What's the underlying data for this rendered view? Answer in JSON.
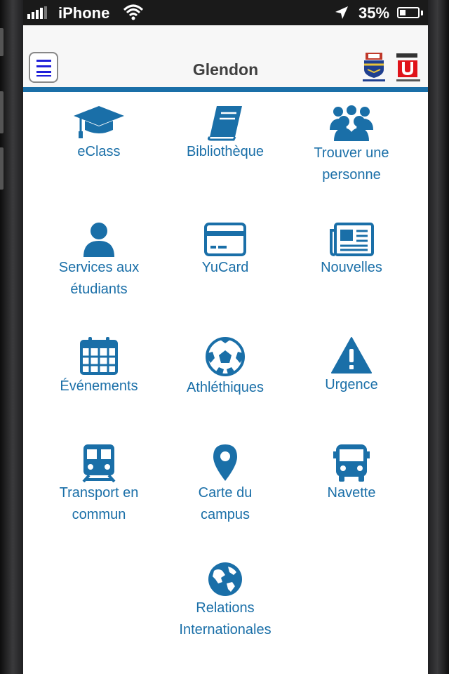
{
  "status_bar": {
    "carrier": "iPhone",
    "battery_percent": "35%",
    "battery_level": 0.35
  },
  "app_bar": {
    "title": "Glendon",
    "menu_icon": "hamburger-menu-icon",
    "logos": [
      "glendon-crest-logo",
      "york-university-logo"
    ]
  },
  "colors": {
    "accent": "#1a6fa8",
    "menu_lines": "#1f1fd9"
  },
  "tiles": [
    {
      "label": "eClass",
      "icon": "graduation-cap-icon"
    },
    {
      "label": "Bibliothèque",
      "icon": "book-icon"
    },
    {
      "label": "Trouver une\npersonne",
      "icon": "people-group-icon"
    },
    {
      "label": "Services aux\nétudiants",
      "icon": "user-icon"
    },
    {
      "label": "YuCard",
      "icon": "credit-card-icon"
    },
    {
      "label": "Nouvelles",
      "icon": "newspaper-icon"
    },
    {
      "label": "Événements",
      "icon": "calendar-icon"
    },
    {
      "label": "Athléthiques",
      "icon": "soccer-ball-icon"
    },
    {
      "label": "Urgence",
      "icon": "warning-icon"
    },
    {
      "label": "Transport en\ncommun",
      "icon": "train-icon"
    },
    {
      "label": "Carte du\ncampus",
      "icon": "map-pin-icon"
    },
    {
      "label": "Navette",
      "icon": "bus-icon"
    },
    {
      "label": "Relations\nInternationales",
      "icon": "globe-icon"
    }
  ]
}
